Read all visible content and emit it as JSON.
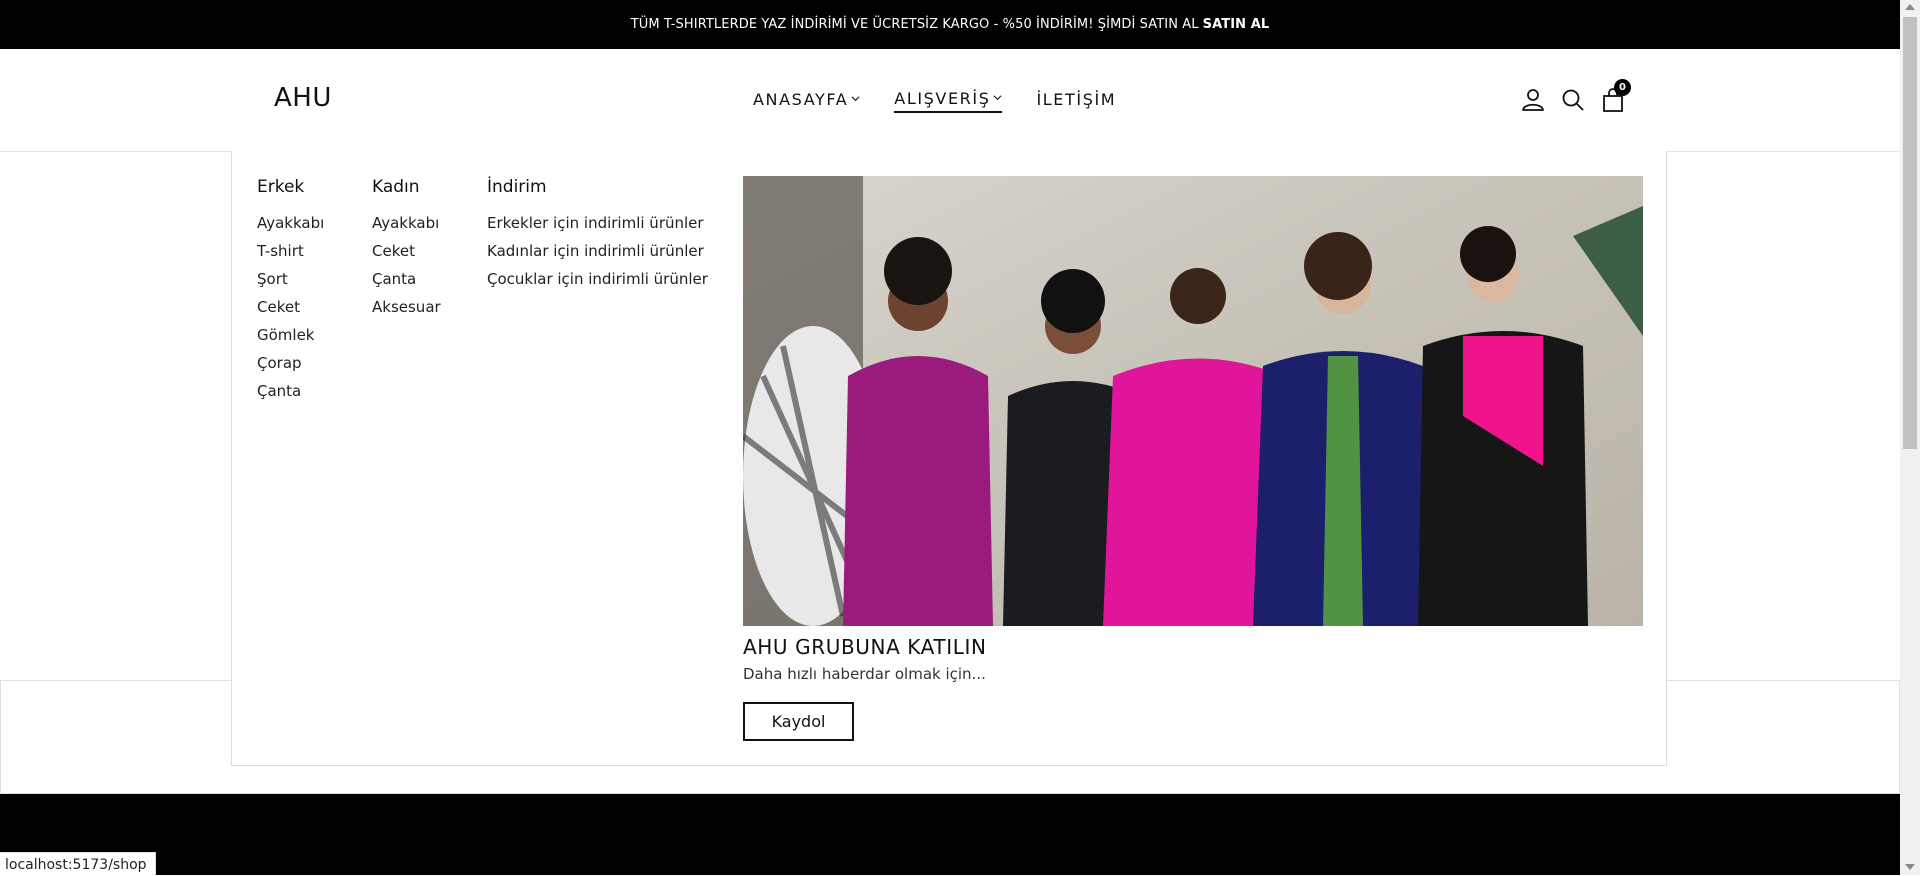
{
  "announcement": {
    "text": "TÜM T-SHIRTLERDE YAZ İNDİRİMİ VE ÜCRETSİZ KARGO - %50 İNDİRİM! ŞİMDİ SATIN AL",
    "cta": "SATIN AL"
  },
  "header": {
    "logo": "AHU",
    "nav": [
      {
        "label": "ANASAYFA",
        "has_dropdown": true,
        "active": false
      },
      {
        "label": "ALIŞVERİŞ",
        "has_dropdown": true,
        "active": true
      },
      {
        "label": "İLETİŞİM",
        "has_dropdown": false,
        "active": false
      }
    ],
    "icons": [
      "user-icon",
      "search-icon",
      "cart-icon"
    ],
    "cart_count": "0"
  },
  "mega_menu": {
    "columns": [
      {
        "title": "Erkek",
        "items": [
          "Ayakkabı",
          "T-shirt",
          "Şort",
          "Ceket",
          "Gömlek",
          "Çorap",
          "Çanta"
        ]
      },
      {
        "title": "Kadın",
        "items": [
          "Ayakkabı",
          "Ceket",
          "Çanta",
          "Aksesuar"
        ]
      },
      {
        "title": "İndirim",
        "items": [
          "Erkekler için indirimli ürünler",
          "Kadınlar için indirimli ürünler",
          "Çocuklar için indirimli ürünler"
        ]
      }
    ],
    "promo": {
      "title": "AHU GRUBUNA KATILIN",
      "subtitle": "Daha hızlı haberdar olmak için...",
      "button": "Kaydol"
    }
  },
  "status_bar": {
    "url": "localhost:5173/shop"
  },
  "colors": {
    "accent": "#000000",
    "magenta": "#e0159a",
    "navy": "#1c1f6b",
    "purple": "#9a1a7e"
  }
}
